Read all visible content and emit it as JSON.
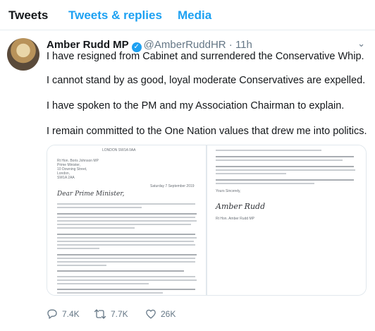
{
  "tabs": [
    {
      "label": "Tweets",
      "active": true
    },
    {
      "label": "Tweets & replies",
      "active": false
    },
    {
      "label": "Media",
      "active": false
    }
  ],
  "tweet": {
    "name": "Amber Rudd MP",
    "handle": "@AmberRuddHR",
    "time": "11h",
    "paragraphs": [
      "I have resigned from Cabinet and surrendered the Conservative Whip.",
      "I cannot stand by as good, loyal moderate Conservatives are expelled.",
      "I have spoken to the PM and my Association Chairman to explain.",
      "I remain committed to the One Nation values that drew me into politics."
    ]
  },
  "letter": {
    "header": "LONDON SW1A 0AA",
    "date": "Saturday 7 September 2019",
    "greeting": "Dear Prime Minister,",
    "recipient": [
      "Rt Hon. Boris Johnson MP",
      "Prime Minister,",
      "10 Downing Street,",
      "London,",
      "SW1A 2AA"
    ],
    "closing": "Yours Sincerely,",
    "signature": "Amber Rudd",
    "signoff": "Rt Hon. Amber Rudd MP"
  },
  "actions": {
    "replies": "7.4K",
    "retweets": "7.7K",
    "likes": "26K"
  },
  "colors": {
    "accent": "#1da1f2",
    "text": "#14171a",
    "muted": "#657786"
  }
}
